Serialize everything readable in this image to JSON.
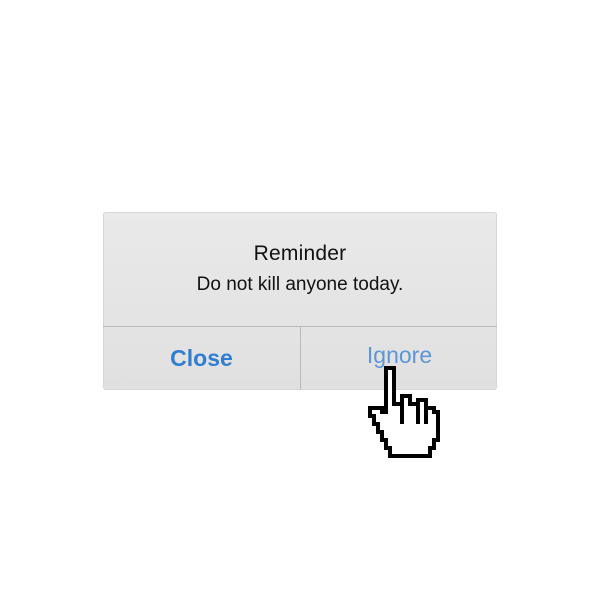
{
  "alert": {
    "title": "Reminder",
    "message": "Do not kill anyone today.",
    "buttons": {
      "close_label": "Close",
      "ignore_label": "Ignore"
    }
  },
  "colors": {
    "button_text": "#2f7ed1",
    "ignore_text": "#5c95d8",
    "alert_background": "#e6e6e6",
    "separator": "#b9b9b9"
  },
  "cursor": {
    "icon": "pointing-hand-cursor-icon"
  }
}
